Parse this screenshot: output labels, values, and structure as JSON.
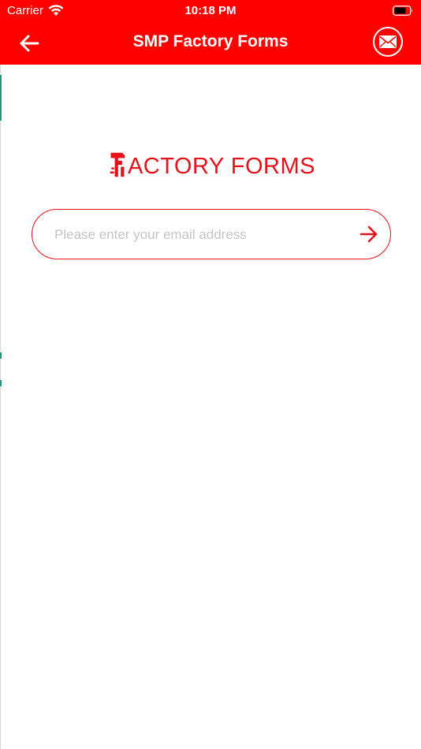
{
  "status_bar": {
    "carrier": "Carrier",
    "time": "10:18 PM",
    "icons": [
      "wifi-icon",
      "battery-icon"
    ]
  },
  "nav": {
    "title": "SMP Factory Forms",
    "back_icon": "arrow-left-icon",
    "mail_icon": "envelope-icon"
  },
  "logo": {
    "text": "ACTORY FORMS"
  },
  "email": {
    "placeholder": "Please enter your email address",
    "value": "",
    "submit_icon": "arrow-right-icon"
  },
  "colors": {
    "brand_red": "#ff0000",
    "logo_red": "#e8101a",
    "placeholder_gray": "#c4c4c6",
    "background": "#ffffff"
  }
}
